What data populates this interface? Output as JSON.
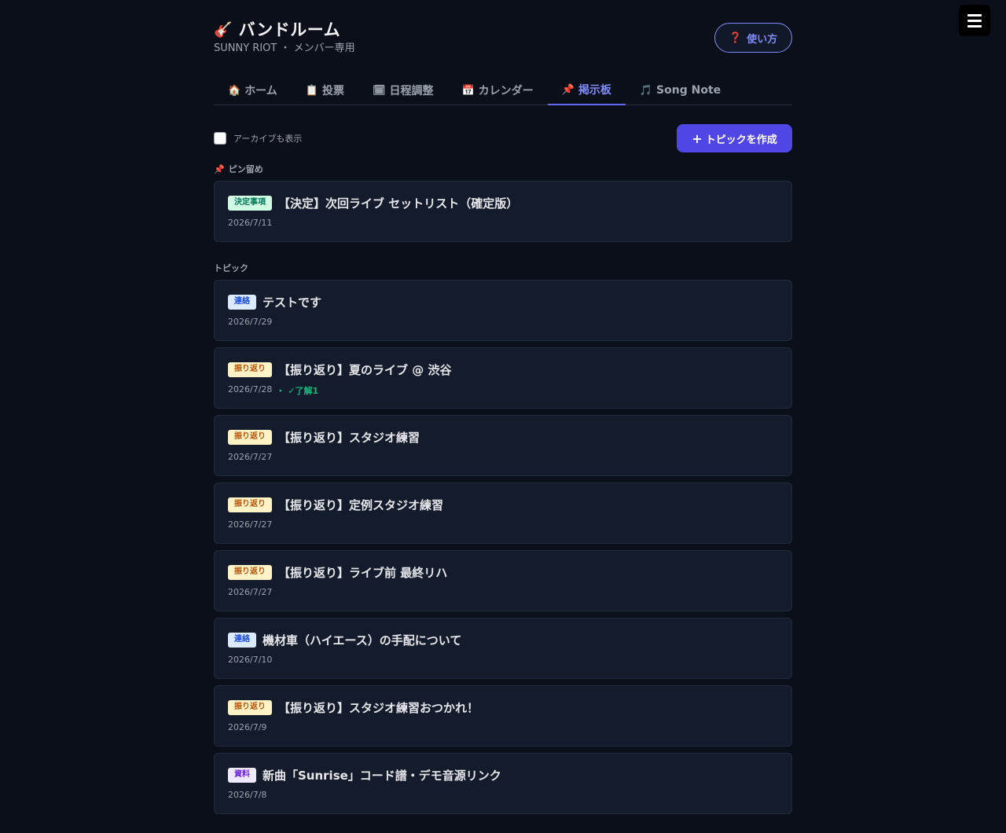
{
  "header": {
    "icon": "🎸",
    "title": "バンドルーム",
    "subtitle": "SUNNY RIOT ・ メンバー専用",
    "help_icon": "❓",
    "help_label": "使い方"
  },
  "tabs": [
    {
      "icon": "🏠",
      "label": "ホーム",
      "active": false
    },
    {
      "icon": "📋",
      "label": "投票",
      "active": false
    },
    {
      "icon": "🗓",
      "label": "日程調整",
      "active": false
    },
    {
      "icon": "📅",
      "label": "カレンダー",
      "active": false
    },
    {
      "icon": "📌",
      "label": "掲示板",
      "active": true
    },
    {
      "icon": "🎵",
      "label": "Song Note",
      "active": false
    }
  ],
  "toolbar": {
    "archive_label": "アーカイブも表示",
    "archive_checked": false,
    "create_plus": "+",
    "create_label": "トピックを作成"
  },
  "pinned_section": {
    "icon": "📌",
    "label": "ピン留め"
  },
  "pinned": [
    {
      "badge": "決定事項",
      "badge_type": "decision",
      "title": "【決定】次回ライブ セットリスト（確定版）",
      "date": "2026/7/11"
    }
  ],
  "topics_section": {
    "label": "トピック"
  },
  "topics": [
    {
      "badge": "連絡",
      "badge_type": "contact",
      "title": "テストです",
      "date": "2026/7/29"
    },
    {
      "badge": "振り返り",
      "badge_type": "review",
      "title": "【振り返り】夏のライブ @ 渋谷",
      "date": "2026/7/28",
      "ack": "・ ✓了解1"
    },
    {
      "badge": "振り返り",
      "badge_type": "review",
      "title": "【振り返り】スタジオ練習",
      "date": "2026/7/27"
    },
    {
      "badge": "振り返り",
      "badge_type": "review",
      "title": "【振り返り】定例スタジオ練習",
      "date": "2026/7/27"
    },
    {
      "badge": "振り返り",
      "badge_type": "review",
      "title": "【振り返り】ライブ前 最終リハ",
      "date": "2026/7/27"
    },
    {
      "badge": "連絡",
      "badge_type": "contact",
      "title": "機材車（ハイエース）の手配について",
      "date": "2026/7/10"
    },
    {
      "badge": "振り返り",
      "badge_type": "review",
      "title": "【振り返り】スタジオ練習おつかれ！",
      "date": "2026/7/9"
    },
    {
      "badge": "資料",
      "badge_type": "material",
      "title": "新曲「Sunrise」コード譜・デモ音源リンク",
      "date": "2026/7/8"
    }
  ],
  "icons": {
    "menu": "hamburger-menu-icon"
  },
  "colors": {
    "accent": "#4f46e5",
    "accent_text": "#818cf8",
    "background": "#0b0f19",
    "card": "#141b2b",
    "ack": "#10b981"
  }
}
